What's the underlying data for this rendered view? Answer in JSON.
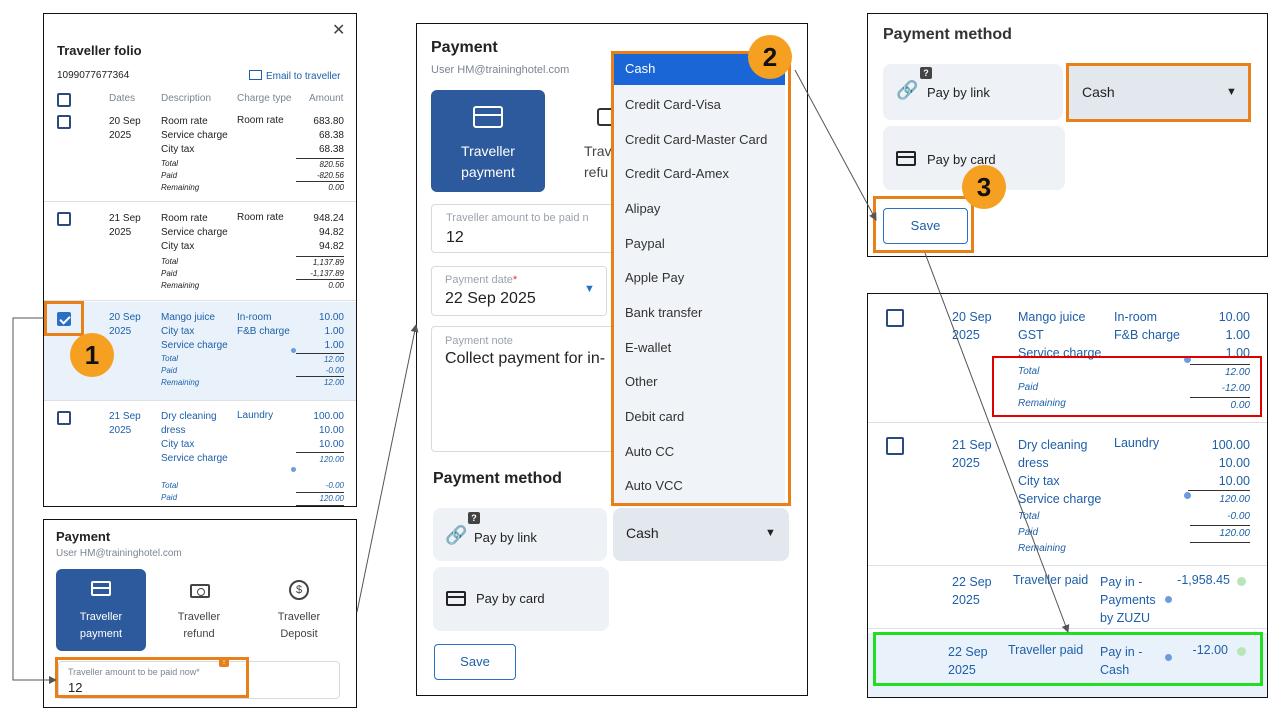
{
  "folio": {
    "title": "Traveller folio",
    "number": "1099077677364",
    "email_label": "Email to traveller",
    "headers": [
      "Dates",
      "Description",
      "Charge type",
      "Amount"
    ],
    "groups": [
      {
        "date1": "20 Sep",
        "date2": "2025",
        "lines": [
          "Room rate",
          "Service charge",
          "City tax"
        ],
        "charge": "Room rate",
        "charge2": "",
        "amounts": [
          "683.80",
          "68.38",
          "68.38"
        ],
        "total": "820.56",
        "paid": "-820.56",
        "remaining": "0.00"
      },
      {
        "date1": "21 Sep",
        "date2": "2025",
        "lines": [
          "Room rate",
          "Service charge",
          "City tax"
        ],
        "charge": "Room rate",
        "charge2": "",
        "amounts": [
          "948.24",
          "94.82",
          "94.82"
        ],
        "total": "1,137.89",
        "paid": "-1,137.89",
        "remaining": "0.00"
      },
      {
        "date1": "20 Sep",
        "date2": "2025",
        "lines": [
          "Mango juice",
          "City tax",
          "Service charge"
        ],
        "charge": "In-room",
        "charge2": "F&B charge",
        "amounts": [
          "10.00",
          "1.00",
          "1.00"
        ],
        "total": "12.00",
        "paid": "-0.00",
        "remaining": "12.00"
      },
      {
        "date1": "21 Sep",
        "date2": "2025",
        "lines": [
          "Dry cleaning",
          "dress",
          "City tax",
          "Service charge"
        ],
        "charge": "Laundry",
        "charge2": "",
        "amounts": [
          "100.00",
          "10.00",
          "10.00",
          "120.00"
        ],
        "total": "-0.00",
        "paid": "120.00",
        "remaining": ""
      }
    ],
    "labels": {
      "total": "Total",
      "paid": "Paid",
      "remaining": "Remaining"
    }
  },
  "payment_small": {
    "title": "Payment",
    "user": "User HM@traininghotel.com",
    "tabs": [
      "Traveller payment",
      "Traveller refund",
      "Traveller Deposit"
    ],
    "tab_lines": [
      [
        "Traveller",
        "payment"
      ],
      [
        "Traveller",
        "refund"
      ],
      [
        "Traveller",
        "Deposit"
      ]
    ],
    "amount_label": "Traveller amount to be paid now*",
    "amount_value": "12"
  },
  "payment_big": {
    "title": "Payment",
    "user": "User HM@traininghotel.com",
    "tab1": [
      "Traveller",
      "payment"
    ],
    "tab2": [
      "Trav",
      "refu"
    ],
    "amount_label": "Traveller amount to be paid n",
    "amount_value": "12",
    "date_label": "Payment date*",
    "date_value": "22 Sep 2025",
    "note_label": "Payment note",
    "note_value": "Collect payment for in-",
    "method_title": "Payment method",
    "pay_by_link": "Pay by link",
    "pay_by_card": "Pay by card",
    "method_value": "Cash",
    "save": "Save",
    "dropdown": [
      "Cash",
      "Credit Card-Visa",
      "Credit Card-Master Card",
      "Credit Card-Amex",
      "Alipay",
      "Paypal",
      "Apple Pay",
      "Bank transfer",
      "E-wallet",
      "Other",
      "Debit card",
      "Auto CC",
      "Auto VCC"
    ]
  },
  "method_panel": {
    "title": "Payment method",
    "pay_by_link": "Pay by link",
    "pay_by_card": "Pay by card",
    "method_value": "Cash",
    "save": "Save"
  },
  "result": {
    "g1": {
      "date1": "20 Sep",
      "date2": "2025",
      "lines": [
        "Mango juice",
        "GST",
        "Service charge"
      ],
      "charge": "In-room",
      "charge2": "F&B charge",
      "amounts": [
        "10.00",
        "1.00",
        "1.00"
      ],
      "total": "12.00",
      "paid": "-12.00",
      "remaining": "0.00"
    },
    "g2": {
      "date1": "21 Sep",
      "date2": "2025",
      "lines": [
        "Dry cleaning",
        "dress",
        "City tax",
        "Service charge"
      ],
      "charge": "Laundry",
      "amounts": [
        "100.00",
        "10.00",
        "10.00",
        "120.00"
      ],
      "total": "-0.00",
      "paid": "120.00"
    },
    "p1": {
      "date1": "22 Sep",
      "date2": "2025",
      "desc": "Traveller paid",
      "type": [
        "Pay in -",
        "Payments",
        "by ZUZU"
      ],
      "amount": "-1,958.45"
    },
    "p2": {
      "date1": "22 Sep",
      "date2": "2025",
      "desc": "Traveller paid",
      "type": [
        "Pay in -",
        "Cash"
      ],
      "amount": "-12.00"
    }
  },
  "badges": [
    "1",
    "2",
    "3"
  ],
  "colors": {
    "accent": "#2d5a9c",
    "orange": "#e8801a",
    "red": "#e00000",
    "green": "#22dd22",
    "link": "#1d5fa8"
  }
}
